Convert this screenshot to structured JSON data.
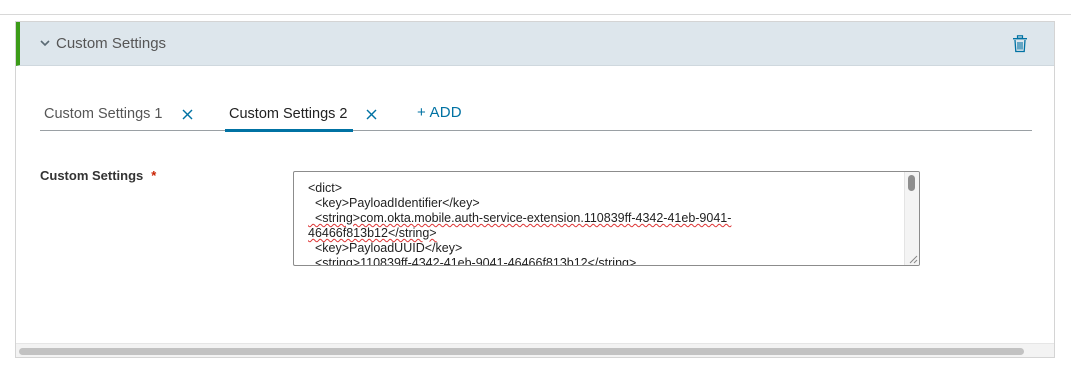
{
  "section": {
    "title": "Custom Settings",
    "accent_color": "#3b9b18",
    "collapse_icon": "chevron-down-icon",
    "delete_icon": "trash-icon"
  },
  "tabs": [
    {
      "label": "Custom Settings 1",
      "active": false,
      "close_icon": "close-icon"
    },
    {
      "label": "Custom Settings 2",
      "active": true,
      "close_icon": "close-icon"
    }
  ],
  "add_tab_label": "+ ADD",
  "link_color": "#0072a3",
  "field": {
    "label": "Custom Settings",
    "required_mark": "*",
    "value_lines": [
      "<dict>",
      "  <key>PayloadIdentifier</key>",
      "  <string>com.okta.mobile.auth-service-extension.110839ff-4342-41eb-9041-",
      "46466f813b12</string>",
      "  <key>PayloadUUID</key>",
      "  <string>110839ff-4342-41eb-9041-46466f813b12</string>"
    ]
  }
}
